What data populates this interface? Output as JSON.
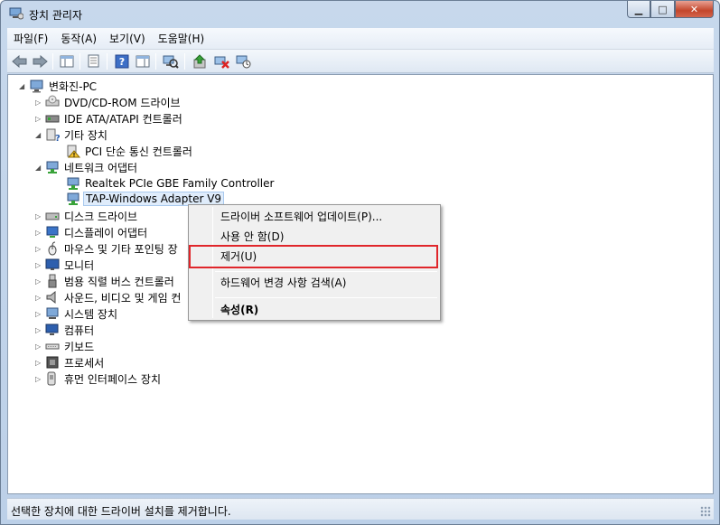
{
  "window": {
    "title": "장치 관리자"
  },
  "menu": [
    "파일(F)",
    "동작(A)",
    "보기(V)",
    "도움말(H)"
  ],
  "tree": {
    "root": "변화진-PC",
    "nodes": {
      "dvd": "DVD/CD-ROM 드라이브",
      "ide": "IDE ATA/ATAPI 컨트롤러",
      "other": "기타 장치",
      "pci": "PCI 단순 통신 컨트롤러",
      "network": "네트워크 어댑터",
      "realtek": "Realtek PCIe GBE Family Controller",
      "tap": "TAP-Windows Adapter V9",
      "disk": "디스크 드라이브",
      "display": "디스플레이 어댑터",
      "mouse": "마우스 및 기타 포인팅 장",
      "monitor": "모니터",
      "usb": "범용 직렬 버스 컨트롤러",
      "sound": "사운드, 비디오 및 게임 컨",
      "system": "시스템 장치",
      "computer": "컴퓨터",
      "keyboard": "키보드",
      "processor": "프로세서",
      "hid": "휴먼 인터페이스 장치"
    }
  },
  "context_menu": {
    "update": "드라이버 소프트웨어 업데이트(P)...",
    "disable": "사용 안 함(D)",
    "uninstall": "제거(U)",
    "scan": "하드웨어 변경 사항 검색(A)",
    "properties": "속성(R)"
  },
  "status": "선택한 장치에 대한 드라이버 설치를 제거합니다.",
  "colors": {
    "highlight_border": "#e0262b",
    "selection": "#dfecfb"
  }
}
